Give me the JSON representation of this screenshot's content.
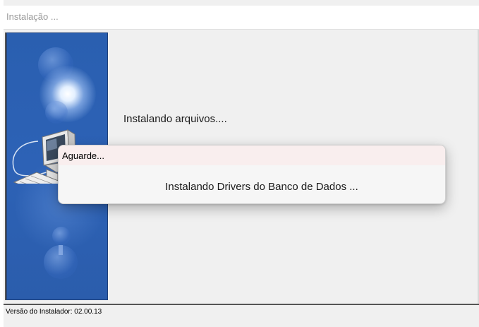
{
  "window": {
    "title": "Instalação ..."
  },
  "main": {
    "status_text": "Instalando arquivos...."
  },
  "dialog": {
    "title": "Aguarde...",
    "message": "Instalando Drivers do Banco de Dados ..."
  },
  "status_bar": {
    "version_text": "Versão do Instalador: 02.00.13"
  },
  "icons": {
    "side_image": "computer-illustration-icon"
  },
  "colors": {
    "side_panel": "#2d62b6",
    "dialog_title_bar": "#f9eeee",
    "window_bg": "#f0f0f0"
  }
}
